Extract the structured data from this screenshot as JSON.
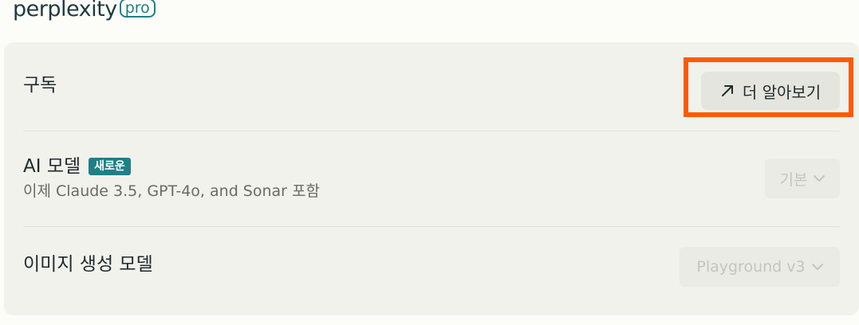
{
  "logo": {
    "word": "perplexity",
    "pro": "pro"
  },
  "settings": {
    "subscription": {
      "title": "구독",
      "button_label": "더 알아보기",
      "button_icon": "arrow-up-right-icon"
    },
    "ai_model": {
      "title": "AI 모델",
      "badge": "새로운",
      "description": "이제 Claude 3.5, GPT-4o, and Sonar 포함",
      "selected": "기본"
    },
    "image_model": {
      "title": "이미지 생성 모델",
      "selected": "Playground v3"
    }
  },
  "colors": {
    "brand": "#1f7f86",
    "highlight": "#ff5a00",
    "panel_bg": "#f2f2ed"
  }
}
